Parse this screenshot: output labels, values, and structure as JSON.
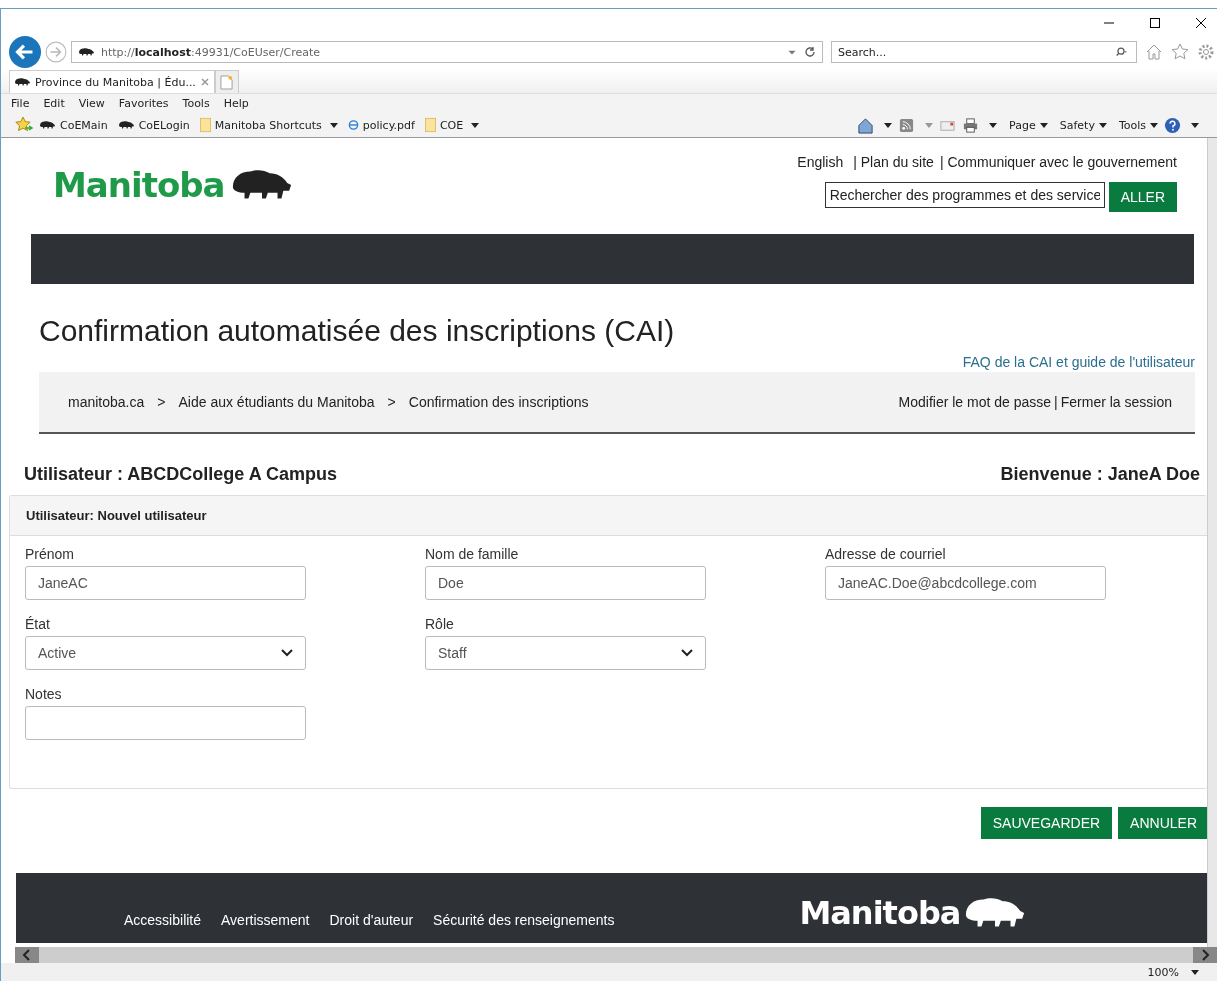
{
  "browser": {
    "address": "http://**localhost**:49931/CoEUser/Create",
    "search_placeholder": "Search...",
    "tab_title": "Province du Manitoba | Édu...",
    "menu": [
      "File",
      "Edit",
      "View",
      "Favorites",
      "Tools",
      "Help"
    ],
    "favorites": [
      {
        "label": "CoEMain",
        "kind": "site",
        "dropdown": false
      },
      {
        "label": "CoELogin",
        "kind": "site",
        "dropdown": false
      },
      {
        "label": "Manitoba Shortcuts",
        "kind": "folder",
        "dropdown": true
      },
      {
        "label": "policy.pdf",
        "kind": "page",
        "dropdown": false
      },
      {
        "label": "COE",
        "kind": "folder",
        "dropdown": true
      }
    ],
    "commands": [
      "Page",
      "Safety",
      "Tools"
    ],
    "zoom": "100%"
  },
  "header": {
    "logo": "Manitoba",
    "links": [
      "English",
      "| Plan du site",
      "| Communiquer avec le gouvernement"
    ],
    "search_placeholder": "Rechercher des programmes et des service",
    "search_button": "ALLER"
  },
  "title": "Confirmation automatisée des inscriptions (CAI)",
  "faq_link": "FAQ de la CAI et guide de l'utilisateur",
  "breadcrumbs": [
    "manitoba.ca",
    "Aide aux étudiants du Manitoba",
    "Confirmation des inscriptions"
  ],
  "breadcrumb_separator": ">",
  "account_links": [
    "Modifier le mot de passe",
    "Fermer la session"
  ],
  "account_separator": "|",
  "user": "Utilisateur : ABCDCollege A Campus",
  "welcome": "Bienvenue : JaneA Doe",
  "panel": {
    "heading": "Utilisateur: Nouvel utilisateur",
    "rows": [
      [
        {
          "label": "Prénom",
          "kind": "text",
          "value": "JaneAC"
        },
        {
          "label": "Nom de famille",
          "kind": "text",
          "value": "Doe"
        },
        {
          "label": "Adresse de courriel",
          "kind": "text",
          "value": "JaneAC.Doe@abcdcollege.com"
        }
      ],
      [
        {
          "label": "État",
          "kind": "select",
          "value": "Active"
        },
        {
          "label": "Rôle",
          "kind": "select",
          "value": "Staff"
        }
      ],
      [
        {
          "label": "Notes",
          "kind": "text"
        }
      ]
    ]
  },
  "buttons": [
    "SAUVEGARDER",
    "ANNULER"
  ],
  "footer": {
    "links": [
      "Accessibilité",
      "Avertissement",
      "Droit d'auteur",
      "Sécurité des renseignements"
    ],
    "logo": "Manitoba"
  }
}
